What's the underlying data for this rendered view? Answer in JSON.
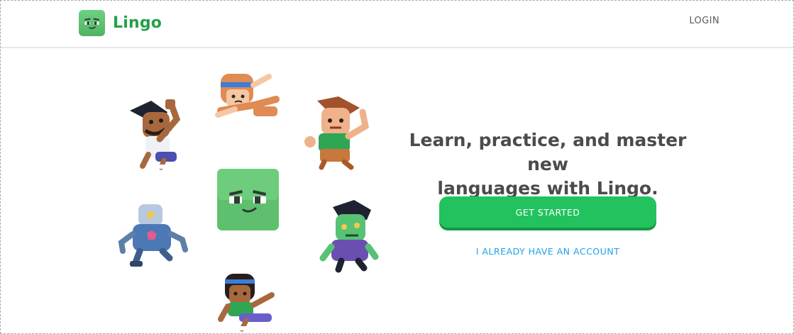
{
  "header": {
    "brand": "Lingo",
    "login_label": "LOGIN"
  },
  "hero": {
    "headline_line1": "Learn, practice, and master new",
    "headline_line2": "languages with Lingo.",
    "get_started_label": "GET STARTED",
    "have_account_label": "I ALREADY HAVE AN ACCOUNT"
  },
  "colors": {
    "brand_green": "#26a048",
    "button_green": "#22c35e",
    "link_blue": "#1ea1e6",
    "text_dark": "#4b4b4b"
  },
  "icons": {
    "logo": "mascot-icon",
    "mascot": "mascot-icon",
    "characters": [
      "dancing-man-icon",
      "headband-girl-icon",
      "waving-boy-icon",
      "robot-icon",
      "zombie-icon",
      "skater-girl-icon"
    ]
  }
}
